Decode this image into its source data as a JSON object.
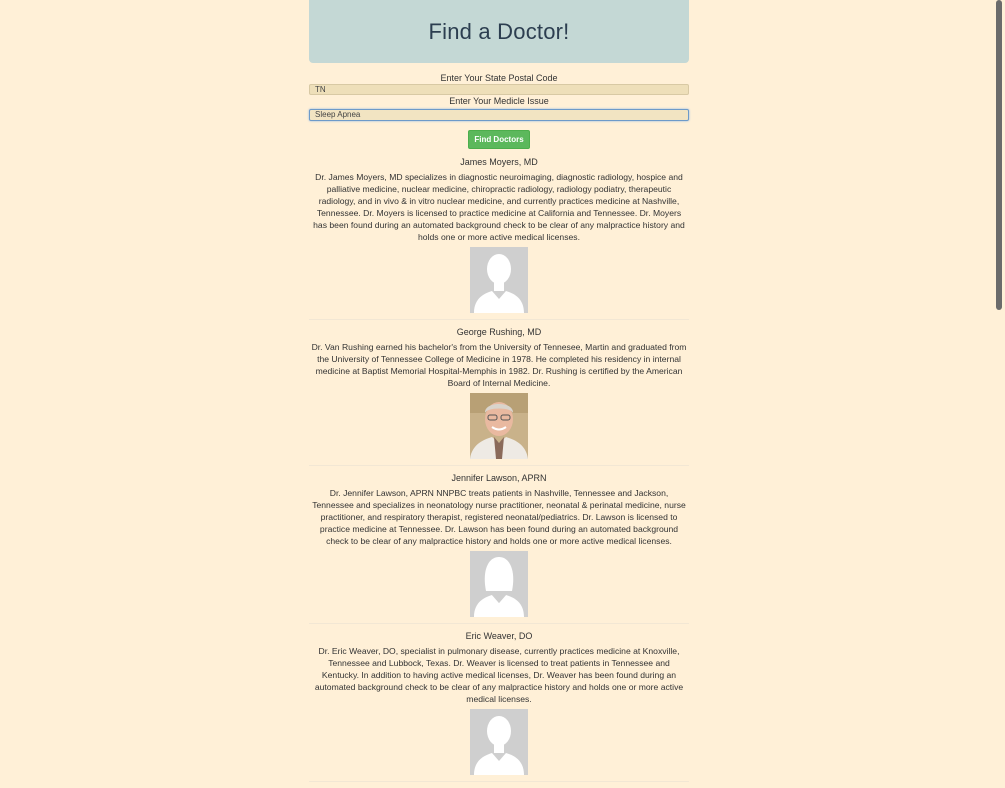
{
  "header": {
    "title": "Find a Doctor!"
  },
  "form": {
    "state_label": "Enter Your State Postal Code",
    "state_value": "TN",
    "issue_label": "Enter Your Medicle Issue",
    "issue_value": "Sleep Apnea",
    "submit_label": "Find Doctors"
  },
  "doctors": [
    {
      "name": "James Moyers, MD",
      "bio": "Dr. James Moyers, MD specializes in diagnostic neuroimaging, diagnostic radiology, hospice and palliative medicine, nuclear medicine, chiropractic radiology, radiology podiatry, therapeutic radiology, and in vivo & in vitro nuclear medicine, and currently practices medicine at Nashville, Tennessee. Dr. Moyers is licensed to practice medicine at California and Tennessee. Dr. Moyers has been found during an automated background check to be clear of any malpractice history and holds one or more active medical licenses.",
      "photo": "male-placeholder"
    },
    {
      "name": "George Rushing, MD",
      "bio": "Dr. Van Rushing earned his bachelor's from the University of Tennesee, Martin and graduated from the University of Tennessee College of Medicine in 1978. He completed his residency in internal medicine at Baptist Memorial Hospital-Memphis in 1982. Dr. Rushing is certified by the American Board of Internal Medicine.",
      "photo": "portrait"
    },
    {
      "name": "Jennifer Lawson, APRN",
      "bio": "Dr. Jennifer Lawson, APRN NNPBC treats patients in Nashville, Tennessee and Jackson, Tennessee and specializes in neonatology nurse practitioner, neonatal & perinatal medicine, nurse practitioner, and respiratory therapist, registered neonatal/pediatrics. Dr. Lawson is licensed to practice medicine at Tennessee. Dr. Lawson has been found during an automated background check to be clear of any malpractice history and holds one or more active medical licenses.",
      "photo": "female-placeholder"
    },
    {
      "name": "Eric Weaver, DO",
      "bio": "Dr. Eric Weaver, DO, specialist in pulmonary disease, currently practices medicine at Knoxville, Tennessee and Lubbock, Texas. Dr. Weaver is licensed to treat patients in Tennessee and Kentucky. In addition to having active medical licenses, Dr. Weaver has been found during an automated background check to be clear of any malpractice history and holds one or more active medical licenses.",
      "photo": "male-placeholder"
    }
  ]
}
